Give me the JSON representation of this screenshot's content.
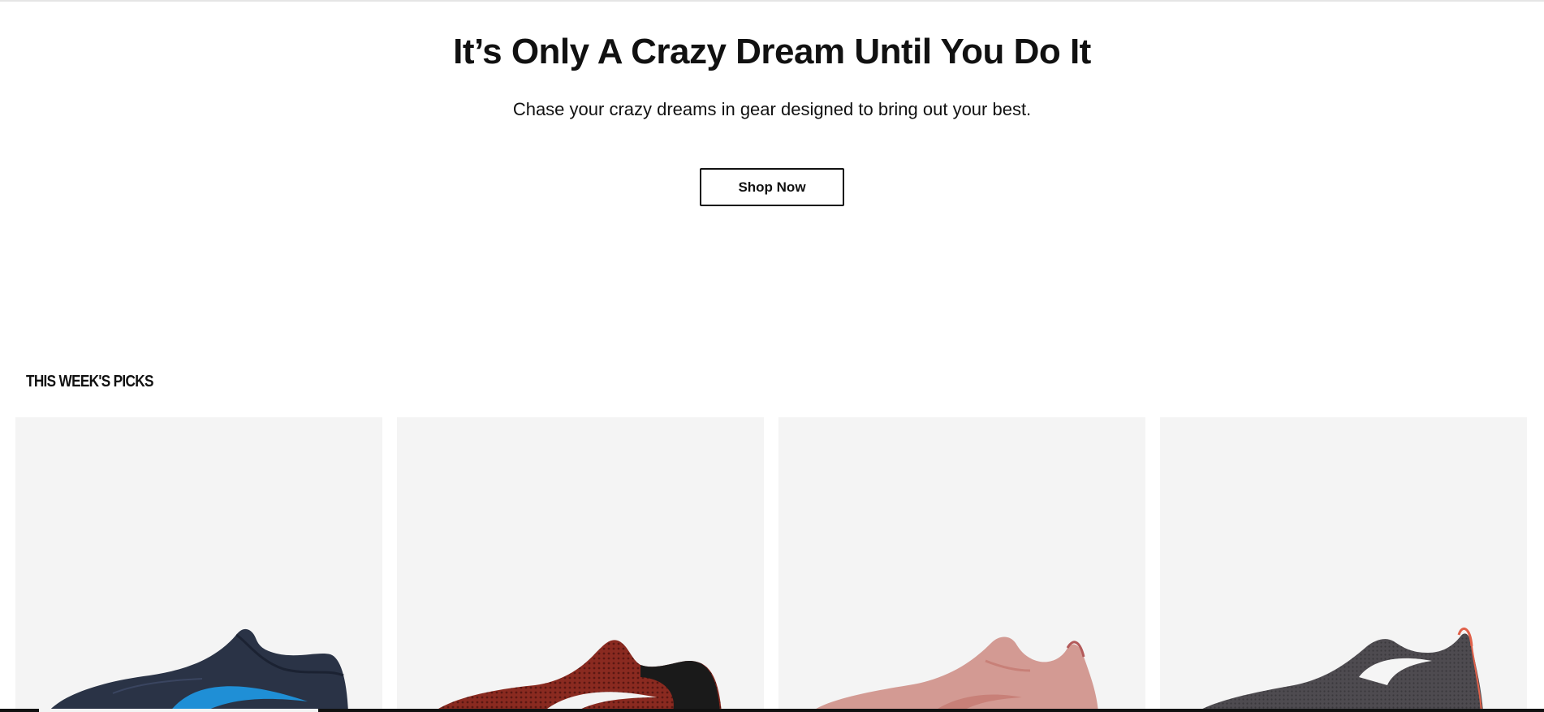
{
  "hero": {
    "title": "It’s Only A Crazy Dream Until You Do It",
    "subtitle": "Chase your crazy dreams in gear designed to bring out your best.",
    "cta_label": "Shop Now"
  },
  "picks": {
    "section_title": "THIS WEEK'S PICKS",
    "products": [
      {
        "shoe_color": "#2a3346",
        "swoosh_color": "#1f8fd6",
        "accent_color": "#1b2232"
      },
      {
        "shoe_color": "#8a2a20",
        "swoosh_color": "#f2f2f2",
        "accent_color": "#1a1a1a"
      },
      {
        "shoe_color": "#d39a93",
        "swoosh_color": "#c88078",
        "accent_color": "#b35a5a"
      },
      {
        "shoe_color": "#4e4b50",
        "swoosh_color": "#f5f5f5",
        "accent_color": "#e0614a"
      }
    ]
  },
  "colors": {
    "text": "#111111",
    "card_background": "#f4f4f4",
    "divider": "#e5e5e5"
  }
}
